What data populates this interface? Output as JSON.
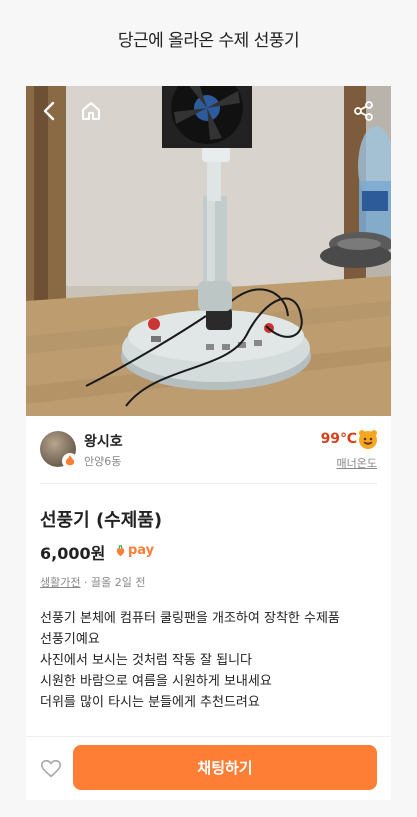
{
  "caption": "당근에 올라온 수제 선풍기",
  "topbar": {
    "back_icon": "chevron-left-icon",
    "home_icon": "home-icon",
    "share_icon": "share-icon"
  },
  "seller": {
    "name": "왕시호",
    "location": "안양6동",
    "manner_temp": "99℃",
    "manner_label": "매너온도"
  },
  "listing": {
    "title": "선풍기 (수제품)",
    "price": "6,000원",
    "pay_label": "pay",
    "category": "생활가전",
    "time": "끌올 2일 전",
    "description": [
      "선풍기 본체에 컴퓨터 쿨링팬을 개조하여 장착한 수제품",
      "선풍기예요",
      "사진에서 보시는 것처럼 작동 잘 됩니다",
      "시원한 바람으로 여름을 시원하게 보내세요",
      "더위를 많이 타시는 분들에게 추천드려요"
    ]
  },
  "actions": {
    "chat_label": "채팅하기",
    "like_icon": "heart-icon"
  },
  "colors": {
    "brand": "#ff7e36",
    "temp": "#d6411a"
  }
}
